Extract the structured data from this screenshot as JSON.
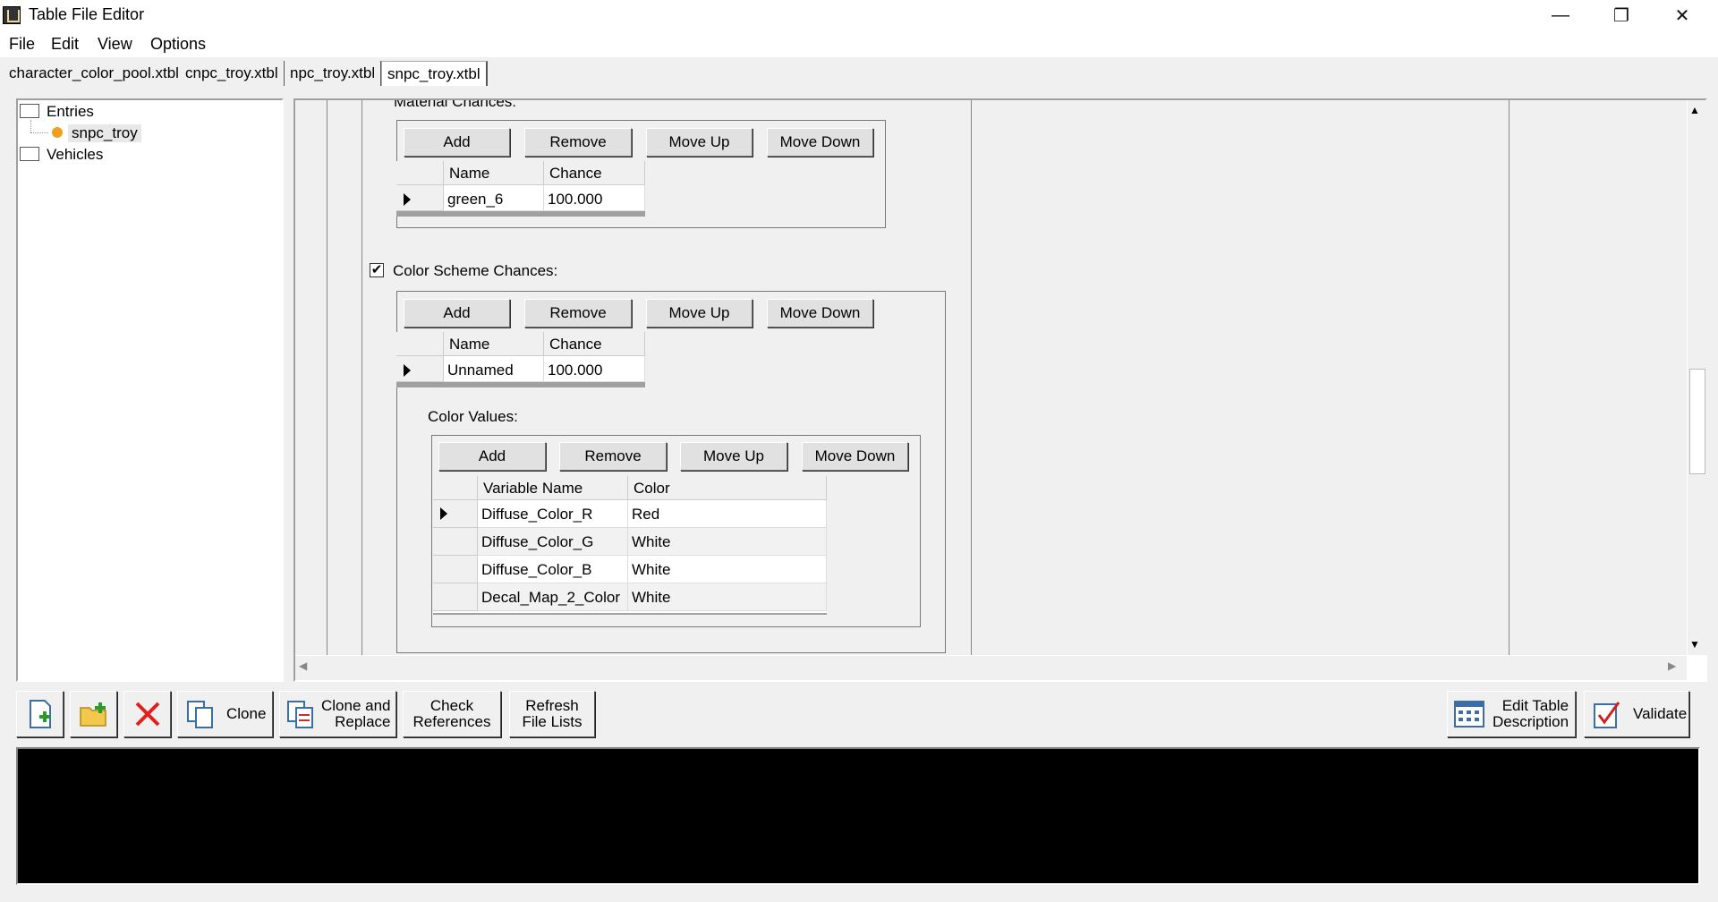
{
  "window": {
    "title": "Table File Editor"
  },
  "menu": [
    "File",
    "Edit",
    "View",
    "Options"
  ],
  "tabs": [
    "character_color_pool.xtbl",
    "cnpc_troy.xtbl",
    "npc_troy.xtbl",
    "snpc_troy.xtbl"
  ],
  "tree": {
    "entries_label": "Entries",
    "entry_item": "snpc_troy",
    "vehicles_label": "Vehicles"
  },
  "material_chances": {
    "label": "Material Chances:",
    "buttons": [
      "Add",
      "Remove",
      "Move Up",
      "Move Down"
    ],
    "columns": [
      "Name",
      "Chance"
    ],
    "rows": [
      {
        "name": "green_6",
        "chance": "100.000"
      }
    ]
  },
  "color_scheme_chances": {
    "label": "Color Scheme Chances:",
    "checked": true,
    "buttons": [
      "Add",
      "Remove",
      "Move Up",
      "Move Down"
    ],
    "columns": [
      "Name",
      "Chance"
    ],
    "rows": [
      {
        "name": "Unnamed",
        "chance": "100.000"
      }
    ]
  },
  "color_values": {
    "label": "Color Values:",
    "buttons": [
      "Add",
      "Remove",
      "Move Up",
      "Move Down"
    ],
    "columns": [
      "Variable Name",
      "Color"
    ],
    "rows": [
      {
        "variable": "Diffuse_Color_R",
        "color": "Red"
      },
      {
        "variable": "Diffuse_Color_G",
        "color": "White"
      },
      {
        "variable": "Diffuse_Color_B",
        "color": "White"
      },
      {
        "variable": "Decal_Map_2_Color",
        "color": "White"
      }
    ]
  },
  "toolbar": {
    "clone": "Clone",
    "clone_replace_1": "Clone and",
    "clone_replace_2": "Replace",
    "check_refs_1": "Check",
    "check_refs_2": "References",
    "refresh_1": "Refresh",
    "refresh_2": "File Lists",
    "edit_desc_1": "Edit Table",
    "edit_desc_2": "Description",
    "validate": "Validate"
  },
  "colors": {
    "accent_orange": "#f0a020",
    "delete_red": "#e02020"
  }
}
